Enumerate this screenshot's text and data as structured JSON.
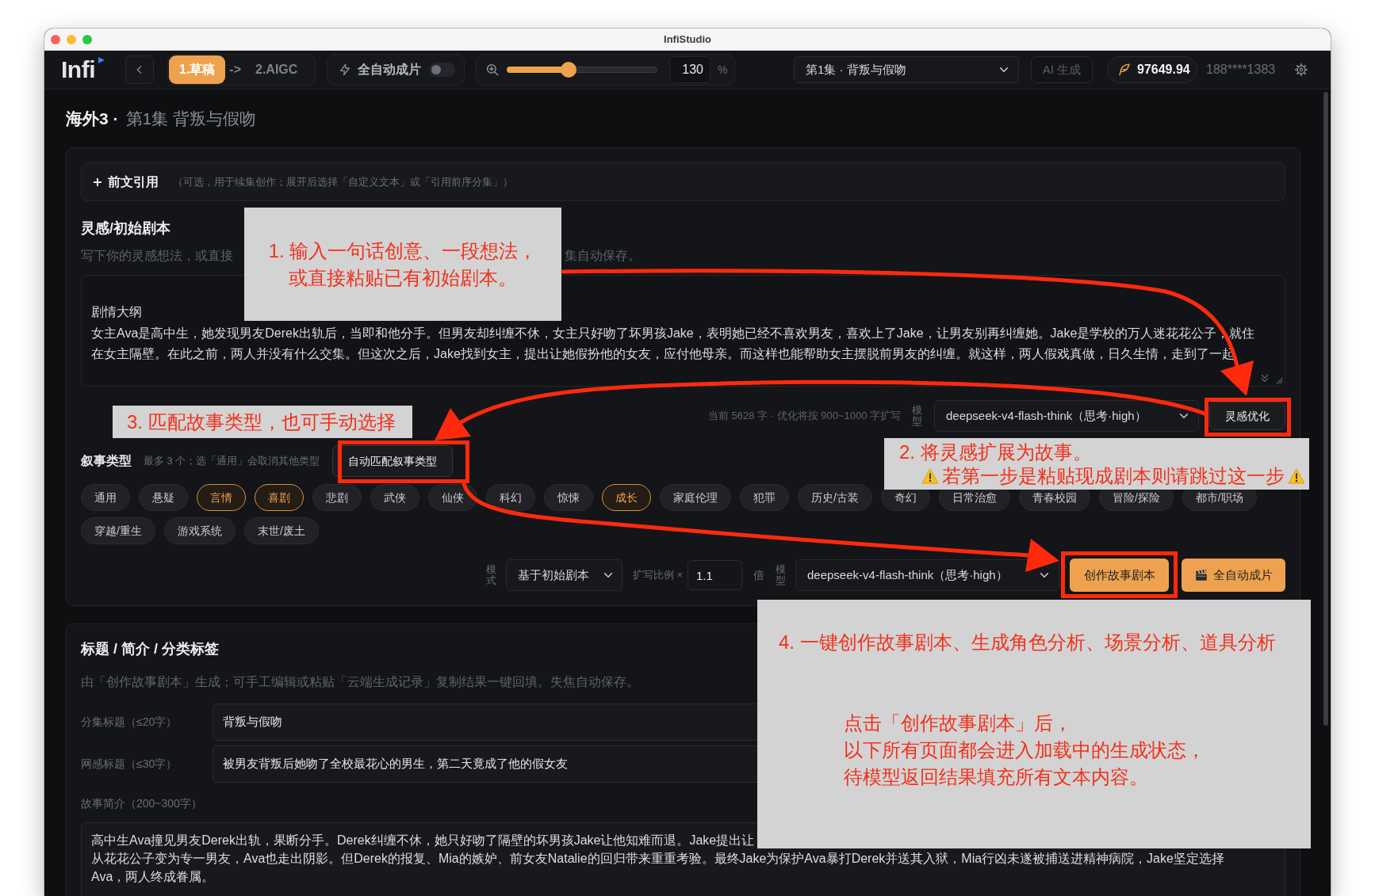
{
  "window": {
    "title": "InfiStudio"
  },
  "toolbar": {
    "logo": "Infi",
    "steps": [
      {
        "label": "1.草稿",
        "selected": true
      },
      {
        "label": "2.AIGC",
        "selected": false
      }
    ],
    "step_arrow": "->",
    "auto_film": {
      "label": "全自动成片",
      "on": false
    },
    "zoom": {
      "level": 0.41,
      "value": "130",
      "unit": "%"
    },
    "episode": "第1集 · 背叛与假吻",
    "ai_generate": {
      "label": "AI 生成",
      "disabled": true
    },
    "balance": "97649.94",
    "account": "188****1383"
  },
  "page_title": {
    "project": "海外3 ·",
    "episode": "第1集 背叛与假吻"
  },
  "inspiration": {
    "prior_reference": {
      "label": "前文引用",
      "expanded": false,
      "hint": "（可选，用于续集创作；展开后选择「自定义文本」或「引用前序分集」）"
    },
    "heading": "灵感/初始剧本",
    "helper": [
      "写下你的灵感想法，或直接",
      "集自动保存。"
    ],
    "script_lines": [
      "剧情大纲",
      "女主Ava是高中生，她发现男友Derek出轨后，当即和他分手。但男友却纠缠不休，女主只好吻了坏男孩Jake，表明她已经不喜欢男友，喜欢上了Jake，让男友别再纠缠她。Jake是学校的万人迷花花公子，就住",
      "在女主隔壁。在此之前，两人并没有什么交集。但这次之后，Jake找到女主，提出让她假扮他的女友，应付他母亲。而这样也能帮助女主摆脱前男友的纠缠。就这样，两人假戏真做，日久生情，走到了一起"
    ],
    "stats": "当前 5628 字 · 优化将按 900~1000 字扩写",
    "model_label": "模型",
    "model": "deepseek-v4-flash-think（思考·high）",
    "optimize_button": "灵感优化",
    "narrative": {
      "label": "叙事类型",
      "hint": "最多 3 个；选「通用」会取消其他类型",
      "auto_button": "自动匹配叙事类型",
      "types": [
        {
          "label": "通用",
          "selected": false
        },
        {
          "label": "悬疑",
          "selected": false
        },
        {
          "label": "言情",
          "selected": true
        },
        {
          "label": "喜剧",
          "selected": true
        },
        {
          "label": "悲剧",
          "selected": false
        },
        {
          "label": "武侠",
          "selected": false
        },
        {
          "label": "仙侠",
          "selected": false
        },
        {
          "label": "科幻",
          "selected": false
        },
        {
          "label": "惊悚",
          "selected": false
        },
        {
          "label": "成长",
          "selected": true
        },
        {
          "label": "家庭伦理",
          "selected": false
        },
        {
          "label": "犯罪",
          "selected": false
        },
        {
          "label": "历史/古装",
          "selected": false
        },
        {
          "label": "奇幻",
          "selected": false
        },
        {
          "label": "日常治愈",
          "selected": false
        },
        {
          "label": "青春校园",
          "selected": false
        },
        {
          "label": "冒险/探险",
          "selected": false
        },
        {
          "label": "都市/职场",
          "selected": false
        },
        {
          "label": "穿越/重生",
          "selected": false
        },
        {
          "label": "游戏系统",
          "selected": false
        },
        {
          "label": "末世/废土",
          "selected": false
        }
      ]
    },
    "create": {
      "mode_label": "模式",
      "mode": "基于初始剧本",
      "ratio_label": "扩写比例 ×",
      "ratio": "1.1",
      "ratio_unit": "倍",
      "model_label": "模型",
      "model": "deepseek-v4-flash-think（思考·high）",
      "create_button": "创作故事剧本",
      "auto_button": "全自动成片"
    }
  },
  "details": {
    "heading": "标题 / 简介 / 分类标签",
    "helper": "由「创作故事剧本」生成；可手工编辑或粘贴「云端生成记录」复制结果一键回填。失焦自动保存。",
    "fields": [
      {
        "label": "分集标题（≤20字）",
        "value": "背叛与假吻"
      },
      {
        "label": "网感标题（≤30字）",
        "value": "被男友背叛后她吻了全校最花心的男生，第二天竟成了他的假女友"
      }
    ],
    "summary_label": "故事简介（200~300字）",
    "summary_lines": [
      "高中生Ava撞见男友Derek出轨，果断分手。Derek纠缠不休，她只好吻了隔壁的坏男孩Jake让他知难而退。Jake提出让",
      "从花花公子变为专一男友，Ava也走出阴影。但Derek的报复、Mia的嫉妒、前女友Natalie的回归带来重重考验。最终Jake为保护Ava暴打Derek并送其入狱，Mia行凶未遂被捕送进精神病院，Jake坚定选择",
      "Ava，两人终成眷属。"
    ]
  },
  "annotations": [
    {
      "lines": [
        {
          "kind": "title",
          "text": "1. 输入一句话创意、一段想法，"
        },
        {
          "kind": "title",
          "text": "或直接粘贴已有初始剧本。"
        }
      ]
    },
    {
      "lines": [
        {
          "kind": "title",
          "text": "3. 匹配故事类型，也可手动选择"
        }
      ]
    },
    {
      "lines": [
        {
          "kind": "title",
          "text": "2. 将灵感扩展为故事。"
        },
        {
          "kind": "warning",
          "text": "若第一步是粘贴现成剧本则请跳过这一步"
        }
      ]
    },
    {
      "lines": [
        {
          "kind": "title",
          "text": "4. 一键创作故事剧本、生成角色分析、场景分析、道具分析"
        },
        {
          "kind": "body",
          "text": "点击「创作故事剧本」后，"
        },
        {
          "kind": "body",
          "text": "以下所有页面都会进入加载中的生成状态，"
        },
        {
          "kind": "body",
          "text": "待模型返回结果填充所有文本内容。"
        }
      ]
    }
  ]
}
